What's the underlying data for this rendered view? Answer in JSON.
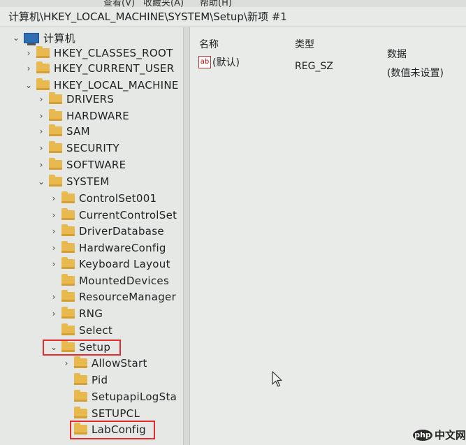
{
  "menubar": {
    "items": [
      "查看(V)",
      "收藏夹(A)",
      "帮助(H)"
    ]
  },
  "address": {
    "path": "计算机\\HKEY_LOCAL_MACHINE\\SYSTEM\\Setup\\新项 #1"
  },
  "tree": {
    "root": "计算机",
    "hkcr": "HKEY_CLASSES_ROOT",
    "hkcu": "HKEY_CURRENT_USER",
    "hklm": "HKEY_LOCAL_MACHINE",
    "drivers": "DRIVERS",
    "hardware": "HARDWARE",
    "sam": "SAM",
    "security": "SECURITY",
    "software": "SOFTWARE",
    "system": "SYSTEM",
    "controlset001": "ControlSet001",
    "currentcontrolset": "CurrentControlSet",
    "driverdatabase": "DriverDatabase",
    "hardwareconfig": "HardwareConfig",
    "keyboardlayout": "Keyboard Layout",
    "mounteddevices": "MountedDevices",
    "resourcemanager": "ResourceManager",
    "rng": "RNG",
    "select": "Select",
    "setup": "Setup",
    "allowstart": "AllowStart",
    "pid": "Pid",
    "setupapilogsta": "SetupapiLogSta",
    "setupcl": "SETUPCL",
    "labconfig": "LabConfig"
  },
  "values": {
    "columns": {
      "name": "名称",
      "type": "类型",
      "data": "数据"
    },
    "rows": [
      {
        "icon": "string-value-icon",
        "name": "(默认)",
        "type": "REG_SZ",
        "data": "(数值未设置)"
      }
    ]
  },
  "watermark": {
    "php": "php",
    "site": "中文网"
  },
  "colors": {
    "highlight": "#e52b2b",
    "folder": "#e8b94e"
  }
}
